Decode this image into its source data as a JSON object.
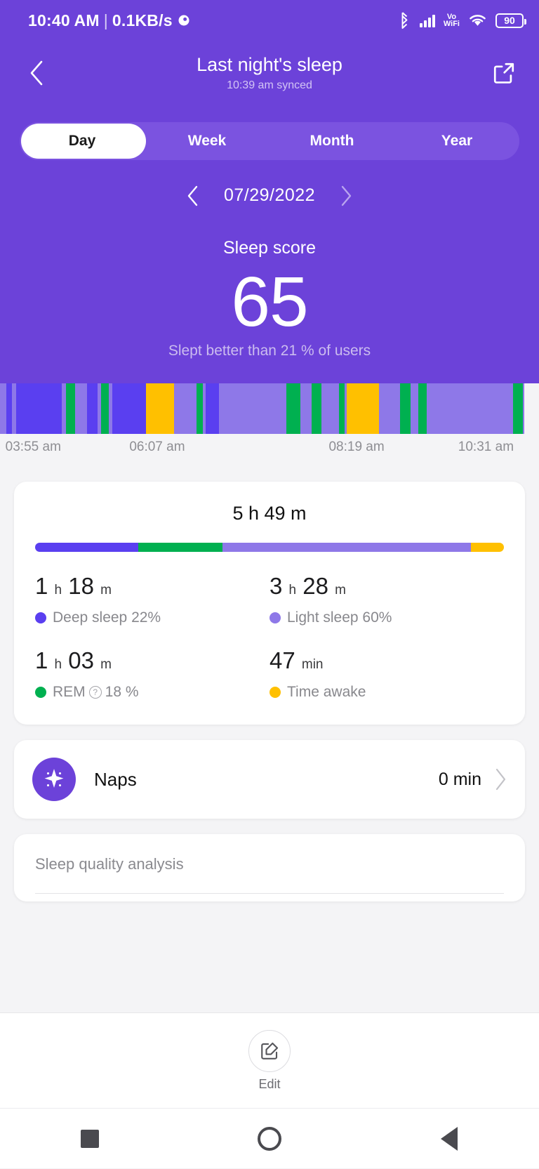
{
  "status_bar": {
    "time": "10:40 AM",
    "separator": "|",
    "net_speed": "0.1KB/s",
    "icons": [
      "location-icon",
      "bluetooth-icon",
      "signal-icon",
      "volte-wifi-icon",
      "wifi-icon",
      "battery-icon"
    ],
    "volte_top": "Vo",
    "volte_bottom": "WiFi",
    "battery_level": "90"
  },
  "header": {
    "back_icon": "chevron-left-icon",
    "title": "Last night's sleep",
    "subtitle": "10:39 am synced",
    "share_icon": "share-external-icon"
  },
  "tabs": {
    "items": [
      {
        "label": "Day",
        "active": true
      },
      {
        "label": "Week",
        "active": false
      },
      {
        "label": "Month",
        "active": false
      },
      {
        "label": "Year",
        "active": false
      }
    ]
  },
  "date_nav": {
    "prev_icon": "chevron-left-icon",
    "date": "07/29/2022",
    "next_icon": "chevron-right-icon"
  },
  "score": {
    "label": "Sleep score",
    "value": "65",
    "comparison": "Slept better than 21 % of users"
  },
  "colors": {
    "deep": "#5a3ff0",
    "light": "#8e78e8",
    "rem": "#00b050",
    "awake": "#ffc000",
    "purple_bg": "#6c42d9",
    "purple_tab": "#7b53e0"
  },
  "chart_data": {
    "type": "bar",
    "title": "Sleep stages hypnogram",
    "xlabel": "",
    "ylabel": "",
    "legend_position": "below-card",
    "grid": false,
    "x_ticks": [
      "03:55 am",
      "06:07 am",
      "08:19 am",
      "10:31 am"
    ],
    "x_tick_positions_pct": [
      1,
      24,
      61,
      85
    ],
    "stage_colors": {
      "deep": "#5a3ff0",
      "light": "#8e78e8",
      "rem": "#00b050",
      "awake": "#ffc000"
    },
    "segments": [
      {
        "stage": "light",
        "width_pct": 1.2
      },
      {
        "stage": "deep",
        "width_pct": 1.0
      },
      {
        "stage": "light",
        "width_pct": 0.8
      },
      {
        "stage": "deep",
        "width_pct": 8.4
      },
      {
        "stage": "light",
        "width_pct": 0.9
      },
      {
        "stage": "rem",
        "width_pct": 1.6
      },
      {
        "stage": "light",
        "width_pct": 2.2
      },
      {
        "stage": "deep",
        "width_pct": 2.0
      },
      {
        "stage": "light",
        "width_pct": 0.6
      },
      {
        "stage": "rem",
        "width_pct": 1.5
      },
      {
        "stage": "light",
        "width_pct": 0.7
      },
      {
        "stage": "deep",
        "width_pct": 6.2
      },
      {
        "stage": "awake",
        "width_pct": 5.2
      },
      {
        "stage": "light",
        "width_pct": 4.2
      },
      {
        "stage": "rem",
        "width_pct": 1.1
      },
      {
        "stage": "light",
        "width_pct": 0.6
      },
      {
        "stage": "deep",
        "width_pct": 2.4
      },
      {
        "stage": "light",
        "width_pct": 12.5
      },
      {
        "stage": "rem",
        "width_pct": 2.6
      },
      {
        "stage": "light",
        "width_pct": 2.1
      },
      {
        "stage": "rem",
        "width_pct": 1.9
      },
      {
        "stage": "light",
        "width_pct": 3.2
      },
      {
        "stage": "rem",
        "width_pct": 1.0
      },
      {
        "stage": "light",
        "width_pct": 0.5
      },
      {
        "stage": "awake",
        "width_pct": 6.0
      },
      {
        "stage": "light",
        "width_pct": 3.8
      },
      {
        "stage": "rem",
        "width_pct": 2.0
      },
      {
        "stage": "light",
        "width_pct": 1.4
      },
      {
        "stage": "rem",
        "width_pct": 1.6
      },
      {
        "stage": "light",
        "width_pct": 16.0
      },
      {
        "stage": "rem",
        "width_pct": 1.8
      },
      {
        "stage": "light",
        "width_pct": 0.3
      }
    ]
  },
  "sleep_card": {
    "total": "5 h 49 m",
    "summary_bar": [
      {
        "stage": "deep",
        "pct": 22
      },
      {
        "stage": "rem",
        "pct": 18
      },
      {
        "stage": "light",
        "pct": 53
      },
      {
        "stage": "awake",
        "pct": 7
      }
    ],
    "stats": [
      {
        "value": "1",
        "unit1": "h",
        "value2": "18",
        "unit2": "m",
        "label": "Deep sleep 22%",
        "color_key": "deep",
        "has_help": false
      },
      {
        "value": "3",
        "unit1": "h",
        "value2": "28",
        "unit2": "m",
        "label": "Light sleep 60%",
        "color_key": "light",
        "has_help": false
      },
      {
        "value": "1",
        "unit1": "h",
        "value2": "03",
        "unit2": "m",
        "label": "REM",
        "label_suffix": "18 %",
        "color_key": "rem",
        "has_help": true
      },
      {
        "value": "47",
        "unit1": "min",
        "value2": "",
        "unit2": "",
        "label": "Time awake",
        "color_key": "awake",
        "has_help": false
      }
    ]
  },
  "naps_card": {
    "icon": "sparkle-icon",
    "label": "Naps",
    "value": "0 min",
    "chevron": "chevron-right-icon"
  },
  "quality_card": {
    "title": "Sleep quality analysis"
  },
  "edit_bar": {
    "icon": "edit-square-icon",
    "label": "Edit"
  },
  "nav_bar": {
    "recent_icon": "square-icon",
    "home_icon": "circle-icon",
    "back_icon": "triangle-back-icon"
  }
}
